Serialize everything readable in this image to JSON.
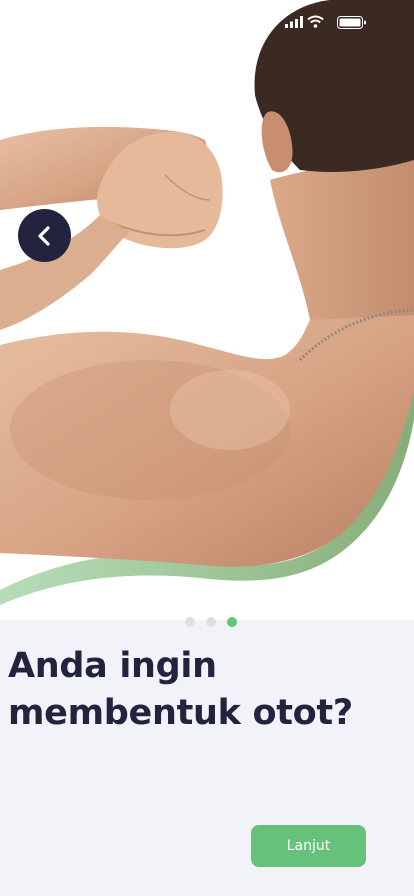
{
  "onboarding": {
    "title": "Anda ingin membentuk otot?",
    "next_label": "Lanjut",
    "page_count": 3,
    "active_page": 3
  },
  "colors": {
    "accent": "#66c27a",
    "dark": "#22233f",
    "background": "#f2f3f8"
  },
  "icons": {
    "back": "chevron-left-icon",
    "signal": "signal-icon",
    "wifi": "wifi-icon",
    "battery": "battery-icon"
  }
}
